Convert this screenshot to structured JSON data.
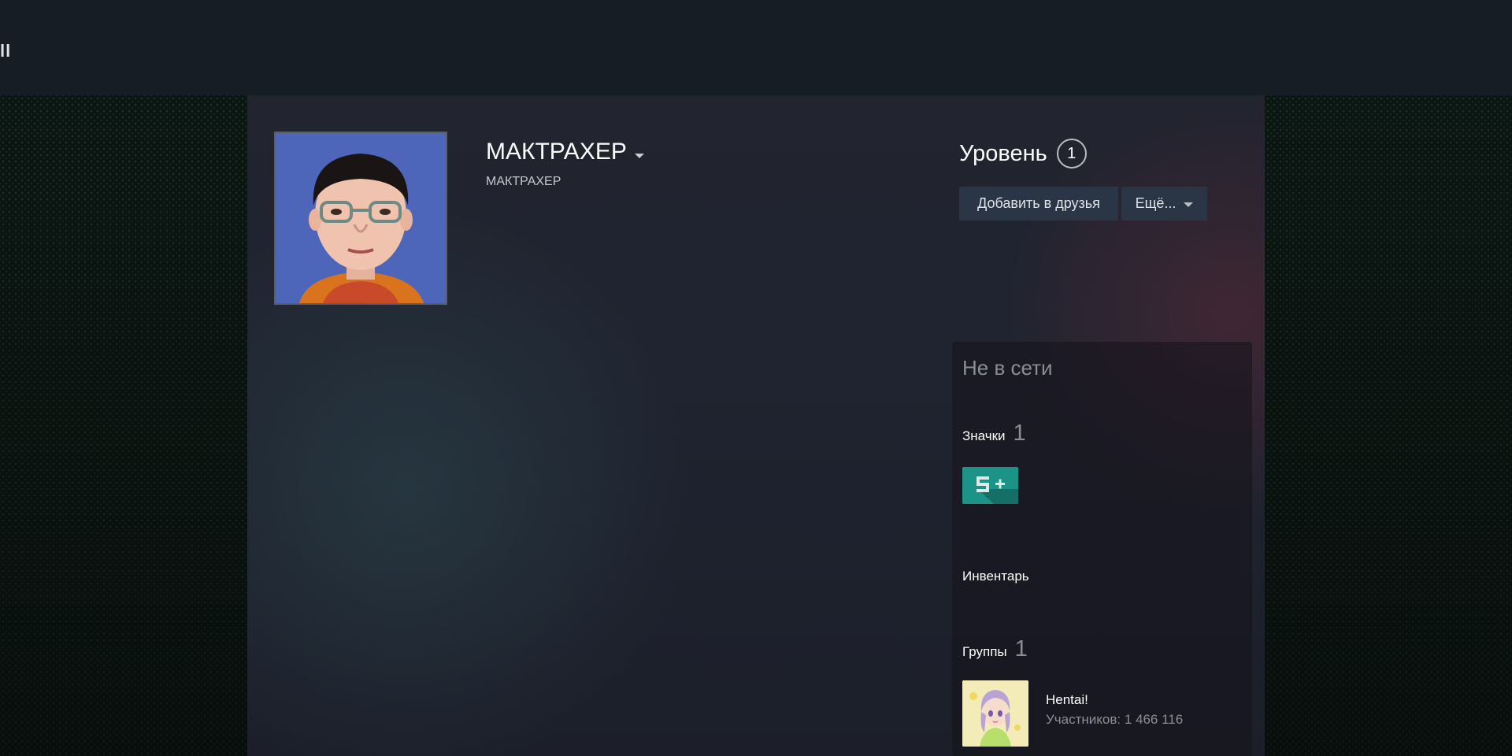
{
  "header": {
    "partial_glyph": "ll"
  },
  "profile": {
    "persona_name": "МАКТРАХЕР",
    "real_name": "МАКТРАХЕР",
    "level_label": "Уровень",
    "level_value": "1",
    "add_friend_label": "Добавить в друзья",
    "more_label": "Ещё..."
  },
  "sidebar": {
    "status": "Не в сети",
    "badges": {
      "label": "Значки",
      "count": "1",
      "badge_icon": "5-plus-years-badge"
    },
    "inventory": {
      "label": "Инвентарь"
    },
    "groups": {
      "label": "Группы",
      "count": "1",
      "items": [
        {
          "name": "Hentai!",
          "members": "Участников: 1 466 116"
        }
      ]
    }
  },
  "colors": {
    "topbar": "#171d25",
    "button_bg": "#2a3545",
    "badge_teal": "#1b9386",
    "muted_text": "#8b8e93"
  }
}
